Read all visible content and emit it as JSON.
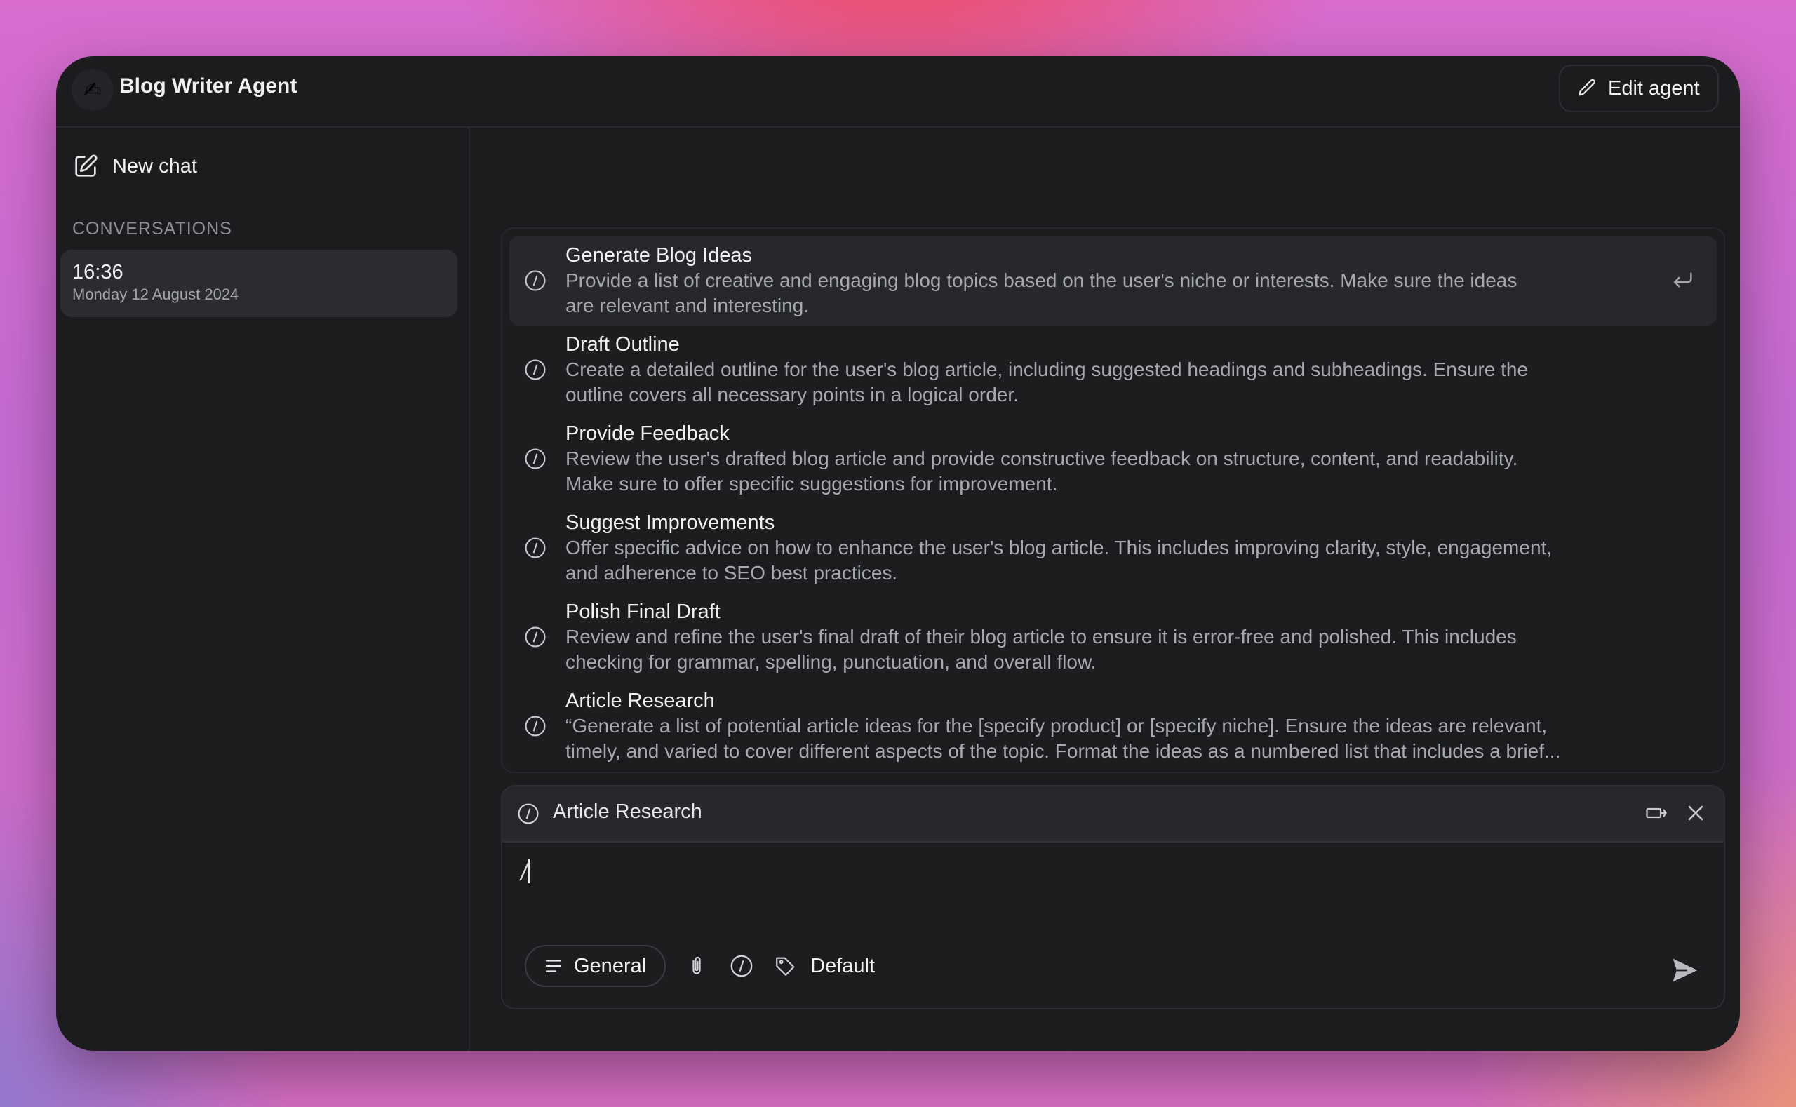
{
  "app": {
    "title": "Blog Writer Agent",
    "logo_icon": "writing-hand-emoji",
    "edit_label": "Edit agent"
  },
  "sidebar": {
    "new_chat_label": "New chat",
    "conversations_header": "CONVERSATIONS",
    "conversations": [
      {
        "time": "16:36",
        "date": "Monday 12 August 2024"
      }
    ]
  },
  "prompts": [
    {
      "title": "Generate Blog Ideas",
      "description": "Provide a list of creative and engaging blog topics based on the user's niche or interests. Make sure the ideas\nare relevant and interesting."
    },
    {
      "title": "Draft Outline",
      "description": "Create a detailed outline for the user's blog article, including suggested headings and subheadings. Ensure the\noutline covers all necessary points in a logical order."
    },
    {
      "title": "Provide Feedback",
      "description": "Review the user's drafted blog article and provide constructive feedback on structure, content, and readability.\nMake sure to offer specific suggestions for improvement."
    },
    {
      "title": "Suggest Improvements",
      "description": "Offer specific advice on how to enhance the user's blog article. This includes improving clarity, style, engagement,\nand adherence to SEO best practices."
    },
    {
      "title": "Polish Final Draft",
      "description": "Review and refine the user's final draft of their blog article to ensure it is error-free and polished. This includes\nchecking for grammar, spelling, punctuation, and overall flow."
    },
    {
      "title": "Article Research",
      "description": "“Generate a list of potential article ideas for the [specify product] or [specify niche]. Ensure the ideas are relevant,\ntimely, and varied to cover different aspects of the topic. Format the ideas as a numbered list that includes a brief..."
    }
  ],
  "composer": {
    "selected_prompt": "Article Research",
    "input_value": "/",
    "mode_label": "General",
    "model_label": "Default"
  },
  "colors": {
    "window_bg": "#1b1c1e",
    "panel_bg": "#26282b",
    "text": "#f1f1f2",
    "muted": "#a6a8ad"
  }
}
